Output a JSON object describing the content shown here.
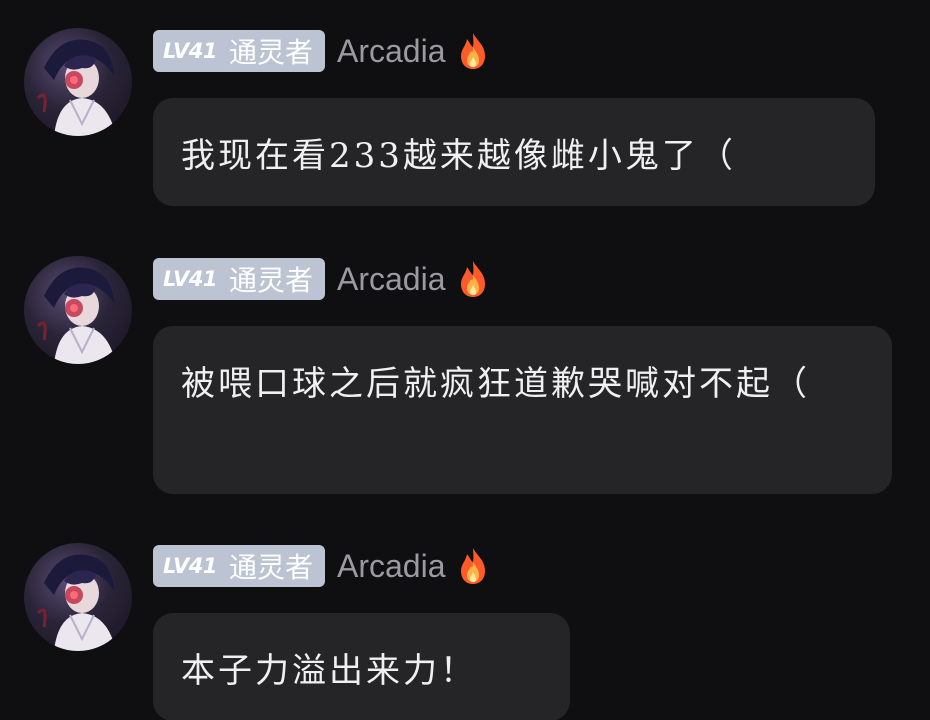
{
  "messages": [
    {
      "level": "LV41",
      "rank": "通灵者",
      "username": "Arcadia",
      "badge_icon": "fire-icon",
      "text": "我现在看233越来越像雌小鬼了（"
    },
    {
      "level": "LV41",
      "rank": "通灵者",
      "username": "Arcadia",
      "badge_icon": "fire-icon",
      "text": "被喂口球之后就疯狂道歉哭喊对不起（"
    },
    {
      "level": "LV41",
      "rank": "通灵者",
      "username": "Arcadia",
      "badge_icon": "fire-icon",
      "text": "本子力溢出来力！"
    }
  ],
  "colors": {
    "background": "#0f0f11",
    "bubble": "#252528",
    "level_badge": "#bcc4d4",
    "username": "#9a9aa0",
    "message_text": "#f0f0f0"
  }
}
